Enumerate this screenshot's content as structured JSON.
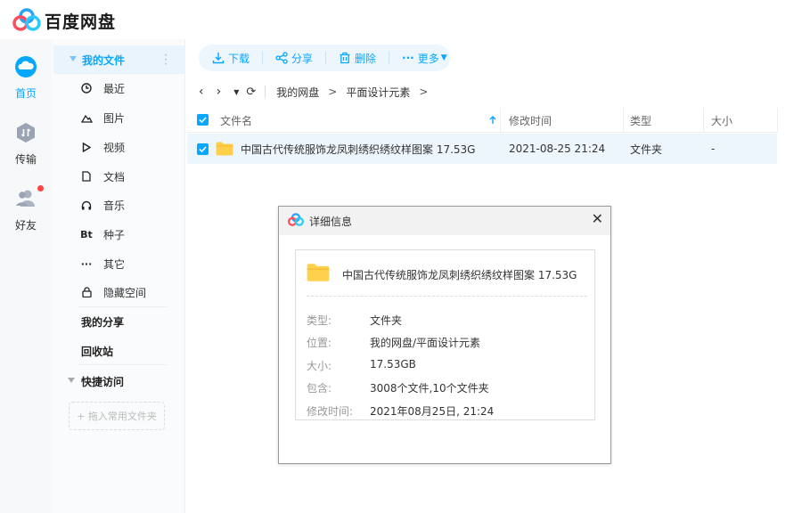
{
  "app": {
    "title": "百度网盘"
  },
  "rail": {
    "items": [
      {
        "label": "首页",
        "icon": "cloud-icon",
        "active": true
      },
      {
        "label": "传输",
        "icon": "transfer-icon",
        "active": false
      },
      {
        "label": "好友",
        "icon": "friends-icon",
        "active": false
      }
    ]
  },
  "sidebar": {
    "root_label": "我的文件",
    "items": [
      {
        "label": "最近",
        "icon": "clock-icon"
      },
      {
        "label": "图片",
        "icon": "picture-icon"
      },
      {
        "label": "视频",
        "icon": "video-icon"
      },
      {
        "label": "文档",
        "icon": "document-icon"
      },
      {
        "label": "音乐",
        "icon": "music-icon"
      },
      {
        "label": "种子",
        "icon": "bt-icon",
        "glyph": "Bt"
      },
      {
        "label": "其它",
        "icon": "more-icon",
        "glyph": "···"
      },
      {
        "label": "隐藏空间",
        "icon": "lock-icon"
      }
    ],
    "my_share": "我的分享",
    "recycle": "回收站",
    "quick_access": "快捷访问",
    "drop_hint": "+ 拖入常用文件夹"
  },
  "toolbar": {
    "download": "下载",
    "share": "分享",
    "delete": "删除",
    "more": "更多"
  },
  "breadcrumb": [
    "我的网盘",
    "平面设计元素"
  ],
  "table": {
    "headers": {
      "name": "文件名",
      "modified": "修改时间",
      "type": "类型",
      "size": "大小"
    },
    "rows": [
      {
        "name": "中国古代传统服饰龙凤刺绣织绣纹样图案 17.53G",
        "modified": "2021-08-25 21:24",
        "type": "文件夹",
        "size": "-"
      }
    ]
  },
  "dialog": {
    "title": "详细信息",
    "file_name": "中国古代传统服饰龙凤刺绣织绣纹样图案 17.53G",
    "fields": [
      {
        "key": "类型:",
        "value": "文件夹"
      },
      {
        "key": "位置:",
        "value": "我的网盘/平面设计元素"
      },
      {
        "key": "大小:",
        "value": "17.53GB"
      },
      {
        "key": "包含:",
        "value": "3008个文件,10个文件夹"
      },
      {
        "key": "修改时间:",
        "value": "2021年08月25日, 21:24"
      }
    ]
  },
  "colors": {
    "accent": "#06a7ff",
    "selected_row": "#eef6fd",
    "folder": "#ffd04b",
    "badge": "#ff4444"
  }
}
